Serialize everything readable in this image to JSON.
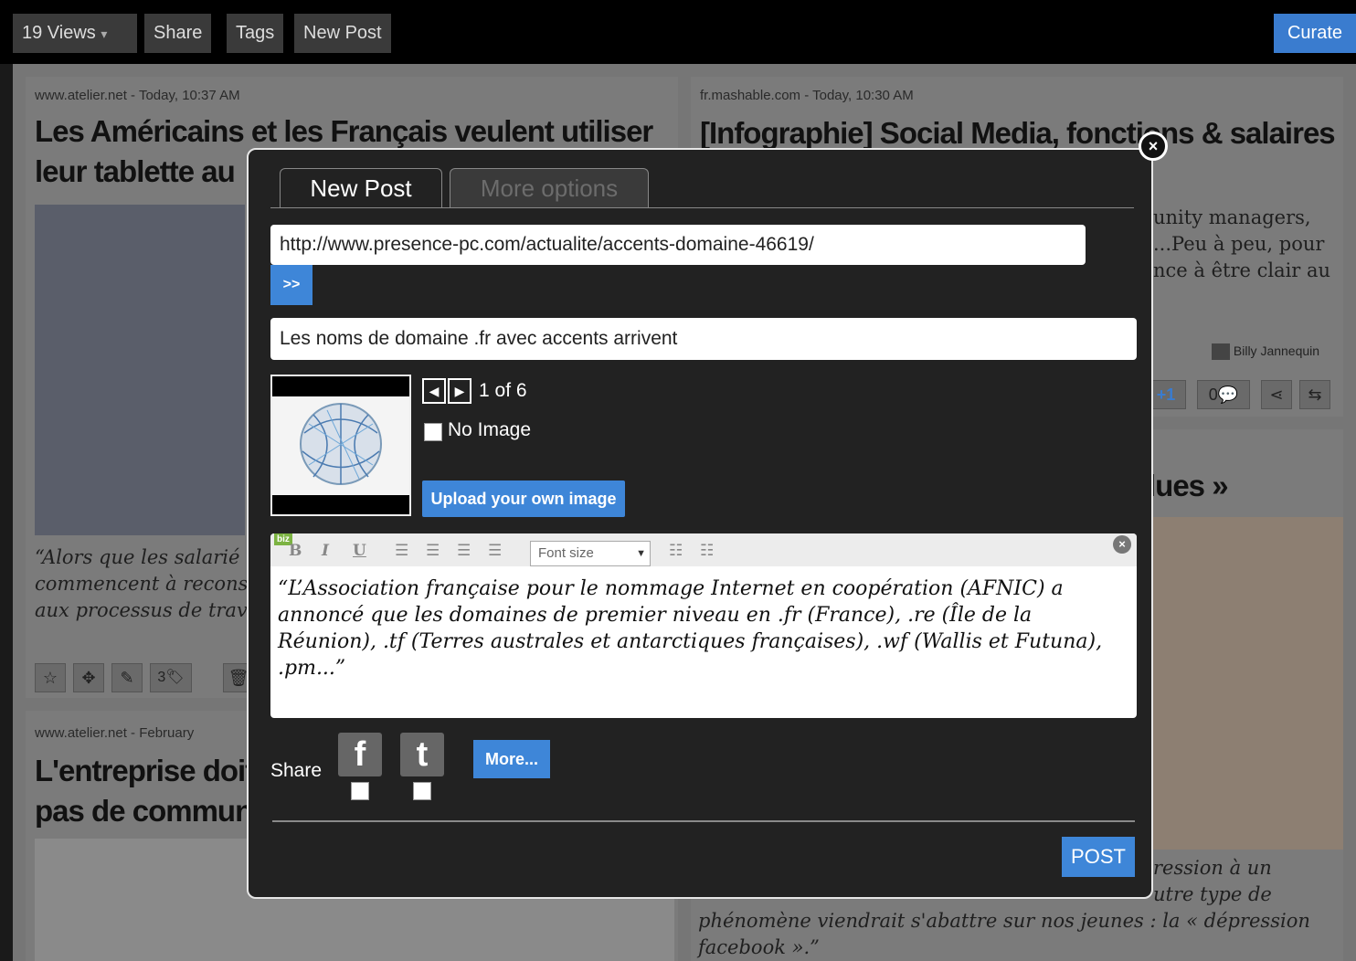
{
  "topbar": {
    "views": "19 Views",
    "views_caret": "▾",
    "share": "Share",
    "tags": "Tags",
    "new_post": "New Post",
    "curate": "Curate"
  },
  "background": {
    "card1": {
      "source": "www.atelier.net - Today, 10:37 AM",
      "title_line1": "Les Américains et les Français veulent utiliser",
      "title_line2": "leur tablette au",
      "quote": [
        "“Alors que les salarié",
        "commencent à recons",
        "aux processus de trav"
      ],
      "count": "3"
    },
    "card2": {
      "source": "fr.mashable.com - Today, 10:30 AM",
      "title": "[Infographie] Social Media, fonctions & salaires",
      "text": [
        "unity managers,",
        "...Peu à peu, pour",
        "nce à être clair au"
      ],
      "author": "Billy Jannequin",
      "comments": "0",
      "plus": "+1"
    },
    "card3": {
      "source": "www.atelier.net - February",
      "title_line1": "L'entreprise doit",
      "title_line2": "pas de communi"
    },
    "card4": {
      "title": "lues »",
      "quote": [
        "ression à un",
        "utre type de",
        "phénomène viendrait s'abattre sur nos jeunes : la « dépression",
        "facebook ».”"
      ]
    }
  },
  "modal": {
    "tabs": [
      "New Post",
      "More options"
    ],
    "url": "http://www.presence-pc.com/actualite/accents-domaine-46619/",
    "go": ">>",
    "title": "Les noms de domaine .fr avec accents arrivent",
    "image_counter": "1 of 6",
    "no_image": "No Image",
    "upload": "Upload your own image",
    "editor": {
      "badge": "biz",
      "bold": "B",
      "italic": "I",
      "underline": "U",
      "font_size": "Font size",
      "text": "“L’Association française pour le nommage Internet en coopération (AFNIC) a annoncé que les domaines de premier niveau en .fr (France), .re (Île de la Réunion), .tf (Terres australes et antarctiques françaises), .wf (Wallis et Futuna), .pm...”"
    },
    "share_label": "Share",
    "more": "More...",
    "post": "POST"
  },
  "colors": {
    "accent": "#3e86d8",
    "modal_bg": "#222222"
  }
}
